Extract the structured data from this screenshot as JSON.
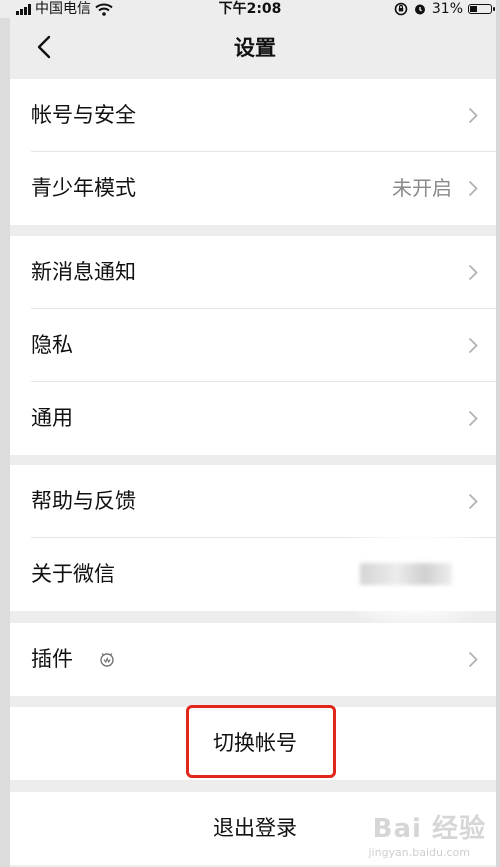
{
  "status_bar": {
    "carrier": "中国电信",
    "time": "下午2:08",
    "battery": "31%"
  },
  "nav": {
    "title": "设置"
  },
  "groups": {
    "account": [
      {
        "label": "帐号与安全"
      },
      {
        "label": "青少年模式",
        "value": "未开启"
      }
    ],
    "notify": [
      {
        "label": "新消息通知"
      },
      {
        "label": "隐私"
      },
      {
        "label": "通用"
      }
    ],
    "about": [
      {
        "label": "帮助与反馈"
      },
      {
        "label": "关于微信"
      }
    ],
    "plugins": [
      {
        "label": "插件"
      }
    ]
  },
  "actions": {
    "switch_account": "切换帐号",
    "logout": "退出登录"
  },
  "watermark": {
    "text": "Bai 经验",
    "sub": "jingyan.baidu.com"
  },
  "colors": {
    "background": "#ededed",
    "highlight": "#e1261c"
  }
}
